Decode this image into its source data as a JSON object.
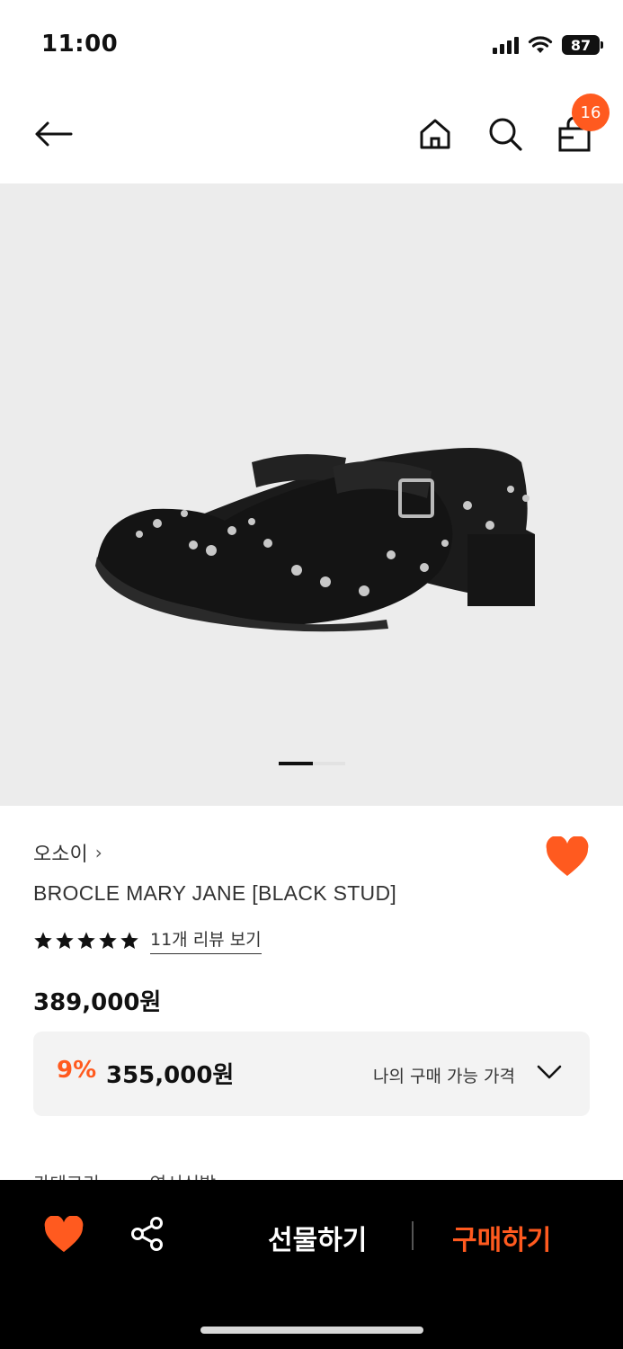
{
  "status_bar": {
    "time": "11:00",
    "battery": "87",
    "icons": [
      "signal-icon",
      "wifi-icon",
      "battery-icon"
    ]
  },
  "header": {
    "icons": [
      "back-arrow-icon",
      "home-icon",
      "search-icon",
      "shopping-bag-icon"
    ],
    "cart_count": "16"
  },
  "gallery": {
    "image": "black studded mary jane shoes",
    "current_page": 1,
    "total_pages": 2
  },
  "product": {
    "brand": "오소이",
    "brand_chevron": "›",
    "name": "BROCLE MARY JANE [BLACK STUD]",
    "rating_stars": 5,
    "review_link": "11개 리뷰 보기",
    "original_price": "389,000원",
    "discount_rate": "9%",
    "sale_price": "355,000원",
    "my_price_label": "나의 구매 가능 가격",
    "wishlisted": true
  },
  "peek": {
    "col1": "카테고리",
    "col2": "연서신발"
  },
  "bottom_bar": {
    "gift_label": "선물하기",
    "buy_label": "구매하기",
    "icons": [
      "heart-icon",
      "share-icon"
    ]
  },
  "colors": {
    "accent": "#ff5a1f",
    "gallery_bg": "#ececec",
    "price_box_bg": "#f3f3f3",
    "bottom_bar_bg": "#000000"
  }
}
